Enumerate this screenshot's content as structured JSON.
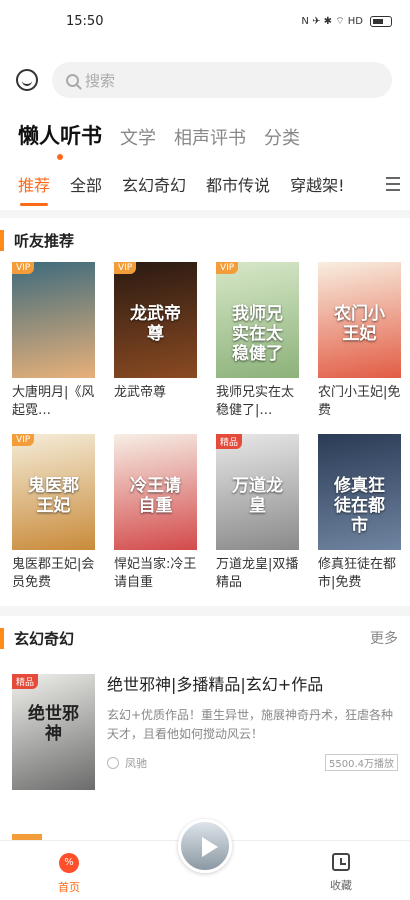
{
  "status": {
    "time": "15:50",
    "icons": "N ✈ ✱ ⌔ HD",
    "battery": "37"
  },
  "search": {
    "placeholder": "搜索"
  },
  "main_tabs": [
    "懒人听书",
    "文学",
    "相声评书",
    "分类"
  ],
  "sub_tabs": [
    "推荐",
    "全部",
    "玄幻奇幻",
    "都市传说",
    "穿越架!"
  ],
  "section1": {
    "title": "听友推荐"
  },
  "books": [
    {
      "title": "大唐明月|《风起霓…",
      "badge": "VIP",
      "cover_text": "",
      "color1": "#3d6b7c",
      "color2": "#e7b07a"
    },
    {
      "title": "龙武帝尊",
      "badge": "VIP",
      "cover_text": "龙武帝尊",
      "color1": "#2a1a12",
      "color2": "#8a4a22"
    },
    {
      "title": "我师兄实在太稳健了|…",
      "badge": "VIP",
      "cover_text": "我师兄实在太稳健了",
      "color1": "#d7e7c8",
      "color2": "#8cb27a"
    },
    {
      "title": "农门小王妃|免费",
      "badge": "",
      "cover_text": "农门小王妃",
      "color1": "#f8eee0",
      "color2": "#e25c44"
    },
    {
      "title": "鬼医郡王妃|会员免费",
      "badge": "VIP",
      "cover_text": "鬼医郡王妃",
      "color1": "#f4ecd8",
      "color2": "#c98b3b"
    },
    {
      "title": "悍妃当家:冷王请自重",
      "badge": "",
      "cover_text": "冷王请自重",
      "color1": "#f6efe6",
      "color2": "#d34a4a"
    },
    {
      "title": "万道龙皇|双播精品",
      "badge": "精品",
      "cover_text": "万道龙皇",
      "color1": "#e7e7e7",
      "color2": "#8a8a8a"
    },
    {
      "title": "修真狂徒在都市|免费",
      "badge": "",
      "cover_text": "修真狂徒在都市",
      "color1": "#2a3b55",
      "color2": "#6f84a0"
    }
  ],
  "section2": {
    "title": "玄幻奇幻",
    "more": "更多"
  },
  "feature": {
    "badge": "精品",
    "cover_text": "绝世邪神",
    "title": "绝世邪神|多播精品|玄幻+作品",
    "desc": "玄幻+优质作品！重生异世，施展神奇丹术，狂虐各种天才，且看他如何搅动风云！",
    "author": "凤驰",
    "plays": "5500.4万播放"
  },
  "nav": {
    "home": "首页",
    "home_badge": "%",
    "fav": "收藏"
  }
}
